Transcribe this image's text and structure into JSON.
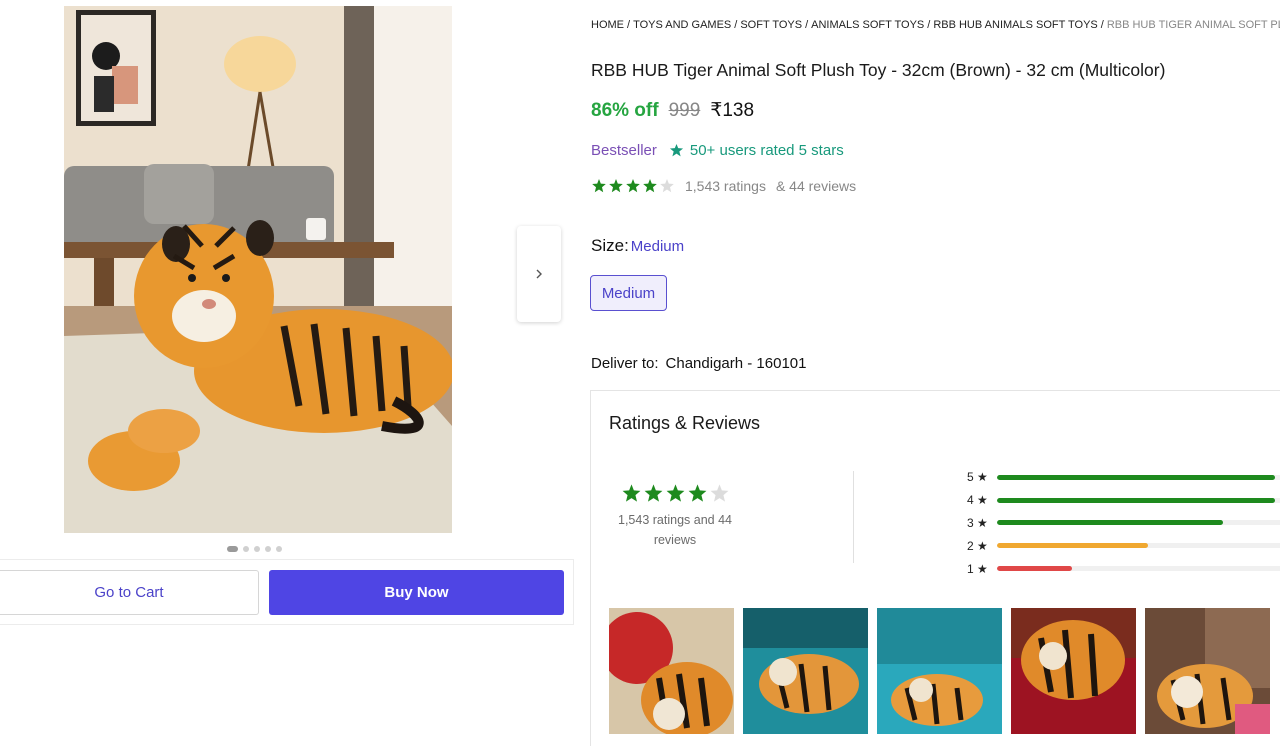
{
  "breadcrumb": [
    {
      "label": "HOME"
    },
    {
      "label": "TOYS AND GAMES"
    },
    {
      "label": "SOFT TOYS"
    },
    {
      "label": "ANIMALS SOFT TOYS"
    },
    {
      "label": "RBB HUB ANIMALS SOFT TOYS"
    },
    {
      "label": "RBB HUB TIGER ANIMAL SOFT PL"
    }
  ],
  "product": {
    "title": "RBB HUB Tiger Animal Soft Plush Toy - 32cm (Brown)  - 32 cm (Multicolor)",
    "discount": "86% off",
    "mrp": "999",
    "price": "₹138",
    "bestseller": "Bestseller",
    "rated_badge": "50+ users rated 5 stars",
    "rating_stars": 4,
    "ratings_count": "1,543 ratings",
    "reviews_count": "& 44 reviews"
  },
  "size": {
    "label": "Size:",
    "selected": "Medium",
    "options": [
      "Medium"
    ]
  },
  "delivery": {
    "label": "Deliver to:",
    "location": "Chandigarh - 160101"
  },
  "actions": {
    "cart": "Go to Cart",
    "buy": "Buy Now"
  },
  "gallery": {
    "dot_count": 5,
    "active_index": 0
  },
  "reviews": {
    "title": "Ratings & Reviews",
    "summary_text": "1,543 ratings and 44 reviews",
    "stars": 4,
    "distribution": [
      {
        "label": "5 ★",
        "fraction": 0.96,
        "color": "#1e8a1e"
      },
      {
        "label": "4 ★",
        "fraction": 0.96,
        "color": "#1e8a1e"
      },
      {
        "label": "3 ★",
        "fraction": 0.78,
        "color": "#1e8a1e"
      },
      {
        "label": "2 ★",
        "fraction": 0.52,
        "color": "#f0a830"
      },
      {
        "label": "1 ★",
        "fraction": 0.26,
        "color": "#e04848"
      }
    ]
  },
  "colors": {
    "accent": "#4f45e4",
    "discount_green": "#26a541",
    "star_green": "#1e8a1e",
    "bestseller_purple": "#7a4fb5",
    "rated_teal": "#18997c"
  }
}
